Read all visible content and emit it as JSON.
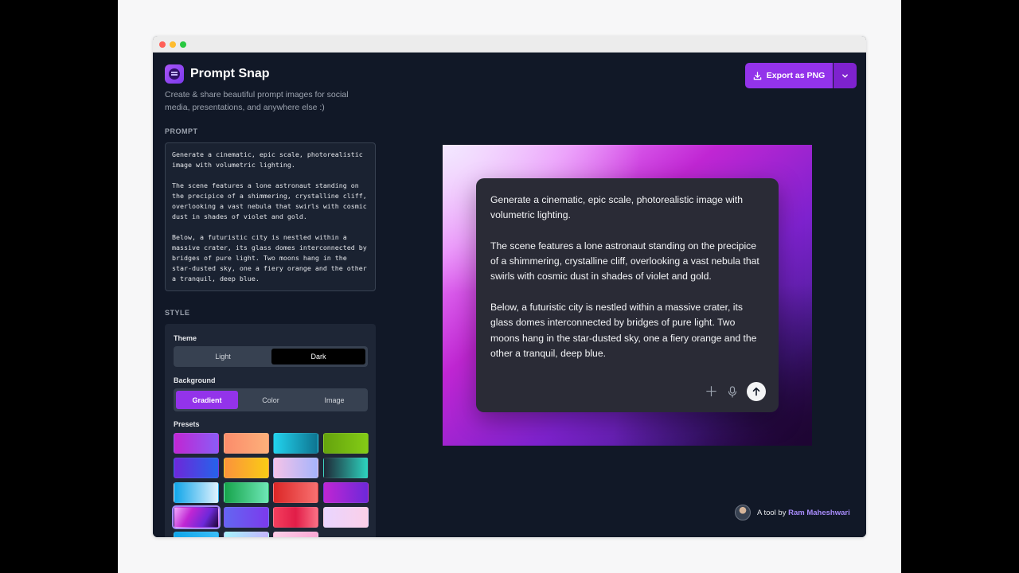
{
  "app": {
    "title": "Prompt Snap",
    "subtitle": "Create & share beautiful prompt images for social media, presentations, and anywhere else :)",
    "logo_icon": "prompt-snap-logo-icon"
  },
  "toolbar": {
    "export_label": "Export as PNG",
    "export_icon": "download-icon",
    "caret_icon": "chevron-down-icon"
  },
  "prompt": {
    "section_label": "PROMPT",
    "text": "Generate a cinematic, epic scale, photorealistic image with volumetric lighting.\n\nThe scene features a lone astronaut standing on the precipice of a shimmering, crystalline cliff, overlooking a vast nebula that swirls with cosmic dust in shades of violet and gold.\n\nBelow, a futuristic city is nestled within a massive crater, its glass domes interconnected by bridges of pure light. Two moons hang in the star-dusted sky, one a fiery orange and the other a tranquil, deep blue."
  },
  "style": {
    "section_label": "STYLE",
    "theme": {
      "label": "Theme",
      "options": [
        "Light",
        "Dark"
      ],
      "selected": "Dark"
    },
    "background": {
      "label": "Background",
      "options": [
        "Gradient",
        "Color",
        "Image"
      ],
      "selected": "Gradient"
    },
    "presets": {
      "label": "Presets",
      "selected_index": 12,
      "swatches": [
        "linear-gradient(90deg,#c026d3,#8b5cf6)",
        "linear-gradient(90deg,#fb8c6b,#fdb07a)",
        "linear-gradient(90deg,#22d3ee,#0e7490)",
        "linear-gradient(90deg,#65a30d,#84cc16)",
        "linear-gradient(90deg,#6d28d9,#2563eb)",
        "linear-gradient(90deg,#fb923c,#facc15)",
        "linear-gradient(90deg,#f5c2e7,#a5b4fc)",
        "linear-gradient(90deg,#1f2937,#2dd4bf)",
        "linear-gradient(90deg,#0ea5e9,#e0f2fe)",
        "linear-gradient(90deg,#16a34a,#6ee7b7)",
        "linear-gradient(90deg,#dc2626,#f87171)",
        "linear-gradient(90deg,#c026d3,#6d28d9)",
        "linear-gradient(120deg,#f0abfc,#c026d3 35%,#6d28d9 70%,#1e0533)",
        "linear-gradient(90deg,#6366f1,#7c3aed)",
        "linear-gradient(90deg,#f43f5e,#e11d48 50%,#fb7185)",
        "linear-gradient(90deg,#e9d5ff,#fbcfe8)",
        "linear-gradient(90deg,#0ea5e9,#38bdf8)",
        "linear-gradient(90deg,#a5f3fc,#c4b5fd)",
        "linear-gradient(90deg,#fbcfe8,#f9a8d4)"
      ]
    }
  },
  "preview": {
    "paragraphs": [
      "Generate a cinematic, epic scale, photorealistic image with volumetric lighting.",
      "The scene features a lone astronaut standing on the precipice of a shimmering, crystalline cliff, overlooking a vast nebula that swirls with cosmic dust in shades of violet and gold.",
      "Below, a futuristic city is nestled within a massive crater, its glass domes interconnected by bridges of pure light. Two moons hang in the star-dusted sky, one a fiery orange and the other a tranquil, deep blue."
    ],
    "icons": [
      "plus-icon",
      "microphone-icon",
      "send-arrow-icon"
    ]
  },
  "credit": {
    "prefix": "A tool by",
    "name": "Ram Maheshwari"
  }
}
